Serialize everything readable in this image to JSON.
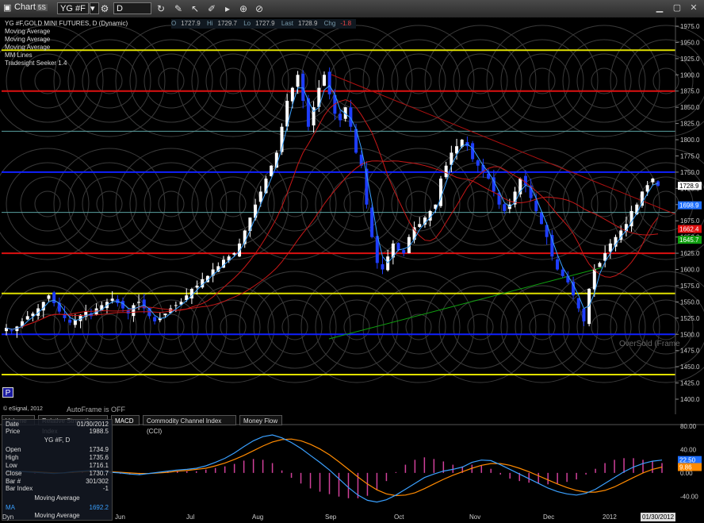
{
  "window": {
    "title": "Chart",
    "title_badge": "5S",
    "symbol": "YG #F",
    "interval": "D"
  },
  "quote": {
    "open_label": "O",
    "open": "1727.9",
    "high_label": "Hi",
    "high": "1729.7",
    "low_label": "Lo",
    "low": "1727.9",
    "last_label": "Last",
    "last": "1728.9",
    "chg_label": "Chg",
    "chg": "-1.8"
  },
  "studies": [
    "YG #F,GOLD MINI FUTURES, D (Dynamic)",
    "Moving Average",
    "Moving Average",
    "Moving Average",
    "MM Lines",
    "Tradesight Seeker 1.4"
  ],
  "overlay": {
    "autoframe": "AutoFrame is OFF",
    "copyright": "© eSignal, 2012",
    "oversold": "OverSold (Frame",
    "p_button": "P",
    "lower_left": "Dyn"
  },
  "tabs": [
    "Volume",
    "Relative Strength Index",
    "MACD",
    "Commodity Channel Index (CCI)",
    "Money Flow"
  ],
  "info_panel": {
    "date_label": "Date",
    "date": "01/30/2012",
    "price_label": "Price",
    "price": "1988.5",
    "symbol": "YG #F, D",
    "open_label": "Open",
    "open": "1734.9",
    "high_label": "High",
    "high": "1735.6",
    "low_label": "Low",
    "low": "1716.1",
    "close_label": "Close",
    "close": "1730.7",
    "bar_label": "Bar #",
    "bar": "301/302",
    "barindex_label": "Bar Index",
    "barindex": "-1",
    "ma_title": "Moving Average",
    "ma_label": "MA",
    "ma": "1692.2",
    "ma_title2": "Moving Average"
  },
  "colors": {
    "bull": "#ffffff",
    "bear": "#1e3dff",
    "ma_fast": "#3aa0ff",
    "ma_mid": "#c81818",
    "ma_slow": "#18a018",
    "red_line": "#dd1010",
    "blue_line": "#1020ff",
    "yellow_line": "#e0e000",
    "teal_line": "#5aa0a0",
    "macd_line": "#3aa0ff",
    "signal_line": "#ff8a00",
    "hist": "#d0409a"
  },
  "chart_data": [
    {
      "type": "candlestick",
      "title": "",
      "y_axis": {
        "min": 1400,
        "max": 1975,
        "ticks": [
          1975,
          1950,
          1925,
          1900,
          1875,
          1850,
          1825,
          1800,
          1775,
          1750,
          1725,
          1700,
          1675,
          1650,
          1625,
          1600,
          1575,
          1550,
          1525,
          1500,
          1475,
          1450,
          1425,
          1400
        ]
      },
      "x_months": [
        "Jun",
        "Jul",
        "Aug",
        "Sep",
        "Oct",
        "Nov",
        "Dec",
        "2012"
      ],
      "last_date_label": "01/30/2012",
      "horizontal_levels": [
        {
          "value": 1938,
          "color": "yellow"
        },
        {
          "value": 1875,
          "color": "red"
        },
        {
          "value": 1813,
          "color": "teal"
        },
        {
          "value": 1750,
          "color": "blue"
        },
        {
          "value": 1688,
          "color": "teal"
        },
        {
          "value": 1625,
          "color": "red"
        },
        {
          "value": 1563,
          "color": "yellow"
        },
        {
          "value": 1500,
          "color": "blue"
        },
        {
          "value": 1438,
          "color": "yellow"
        }
      ],
      "price_flags": [
        {
          "value": "1728.9",
          "color": "#ffffff",
          "text_color": "#000000"
        },
        {
          "value": "1698.9",
          "color": "#1e6fff",
          "text_color": "#ffffff"
        },
        {
          "value": "1662.4",
          "color": "#e01010",
          "text_color": "#ffffff"
        },
        {
          "value": "1645.7",
          "color": "#10a010",
          "text_color": "#ffffff"
        }
      ],
      "close_path": [
        1510,
        1505,
        1512,
        1520,
        1528,
        1532,
        1540,
        1550,
        1560,
        1548,
        1535,
        1525,
        1518,
        1522,
        1530,
        1535,
        1528,
        1540,
        1545,
        1550,
        1555,
        1548,
        1540,
        1532,
        1545,
        1550,
        1540,
        1528,
        1520,
        1525,
        1532,
        1540,
        1545,
        1550,
        1560,
        1570,
        1575,
        1585,
        1590,
        1600,
        1605,
        1615,
        1620,
        1625,
        1640,
        1660,
        1680,
        1700,
        1720,
        1740,
        1760,
        1780,
        1820,
        1860,
        1880,
        1900,
        1860,
        1820,
        1850,
        1880,
        1900,
        1870,
        1840,
        1830,
        1850,
        1820,
        1780,
        1760,
        1700,
        1650,
        1610,
        1600,
        1620,
        1640,
        1630,
        1625,
        1650,
        1665,
        1670,
        1680,
        1690,
        1700,
        1740,
        1760,
        1780,
        1790,
        1800,
        1790,
        1770,
        1760,
        1750,
        1740,
        1720,
        1700,
        1690,
        1700,
        1720,
        1740,
        1730,
        1710,
        1690,
        1670,
        1650,
        1620,
        1600,
        1590,
        1580,
        1560,
        1540,
        1520,
        1570,
        1600,
        1610,
        1625,
        1640,
        1650,
        1660,
        1670,
        1690,
        1700,
        1720,
        1730,
        1740,
        1729
      ]
    },
    {
      "type": "line",
      "title": "MACD",
      "y_axis": {
        "min": -60,
        "max": 80,
        "ticks": [
          80,
          40,
          0,
          -40
        ]
      },
      "macd_flag": "22.50",
      "signal_flag": "9.86",
      "macd": [
        2,
        3,
        2,
        1,
        0,
        -1,
        0,
        2,
        3,
        4,
        3,
        1,
        0,
        -2,
        -3,
        -1,
        1,
        3,
        5,
        6,
        8,
        12,
        18,
        25,
        34,
        45,
        55,
        62,
        65,
        60,
        52,
        42,
        30,
        18,
        5,
        -10,
        -25,
        -38,
        -47,
        -50,
        -46,
        -38,
        -28,
        -18,
        -8,
        -2,
        3,
        6,
        10,
        18,
        22,
        21,
        14,
        6,
        -2,
        -10,
        -18,
        -26,
        -32,
        -36,
        -38,
        -35,
        -28,
        -18,
        -8,
        2,
        10,
        16,
        20,
        22
      ],
      "signal": [
        1,
        2,
        2,
        2,
        1,
        0,
        0,
        1,
        2,
        3,
        3,
        2,
        1,
        0,
        -1,
        -1,
        0,
        1,
        3,
        4,
        6,
        8,
        12,
        17,
        23,
        30,
        38,
        46,
        53,
        57,
        58,
        55,
        49,
        41,
        31,
        19,
        6,
        -7,
        -19,
        -29,
        -36,
        -39,
        -38,
        -34,
        -27,
        -19,
        -11,
        -4,
        2,
        8,
        13,
        16,
        16,
        13,
        8,
        2,
        -5,
        -12,
        -19,
        -25,
        -30,
        -33,
        -33,
        -30,
        -24,
        -16,
        -8,
        0,
        6,
        10
      ]
    }
  ]
}
